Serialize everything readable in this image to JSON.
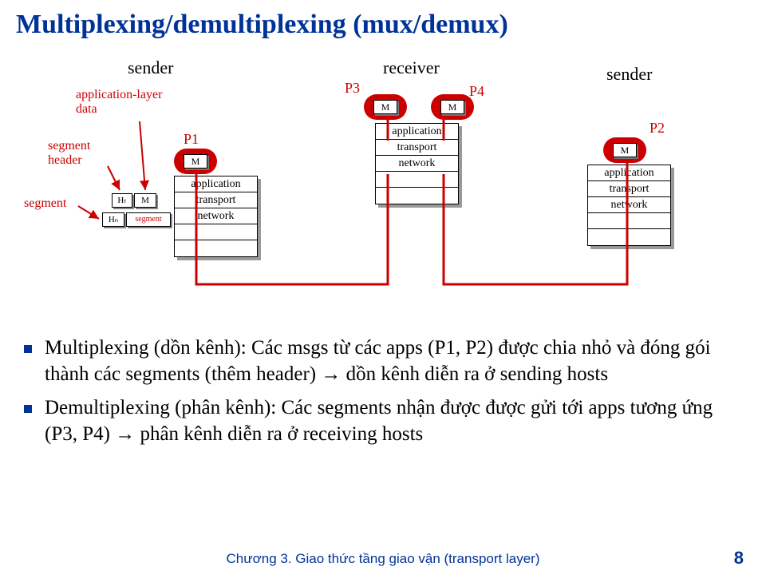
{
  "title": "Multiplexing/demultiplexing (mux/demux)",
  "roles": {
    "sender_left": "sender",
    "receiver": "receiver",
    "sender_right": "sender"
  },
  "red_labels": {
    "app_layer_data": "application-layer\ndata",
    "segment_header": "segment\nheader",
    "segment": "segment"
  },
  "procs": {
    "p1": "P1",
    "p2": "P2",
    "p3": "P3",
    "p4": "P4",
    "m": "M"
  },
  "stack": {
    "application": "application",
    "transport": "transport",
    "network": "network"
  },
  "segparts": {
    "ht": "Hₜ",
    "m": "M",
    "hn": "Hₙ",
    "segment": "segment"
  },
  "bullets": [
    "Multiplexing (dồn kênh): Các msgs từ các apps (P1, P2)  được chia nhỏ và đóng gói thành các segments (thêm header) → dồn kênh diễn ra ở sending hosts",
    "Demultiplexing (phân kênh): Các segments nhận được được gửi tới apps tương ứng (P3, P4) → phân kênh diễn ra ở receiving hosts"
  ],
  "footer": "Chương 3. Giao thức tầng giao vận (transport layer)",
  "page": "8"
}
